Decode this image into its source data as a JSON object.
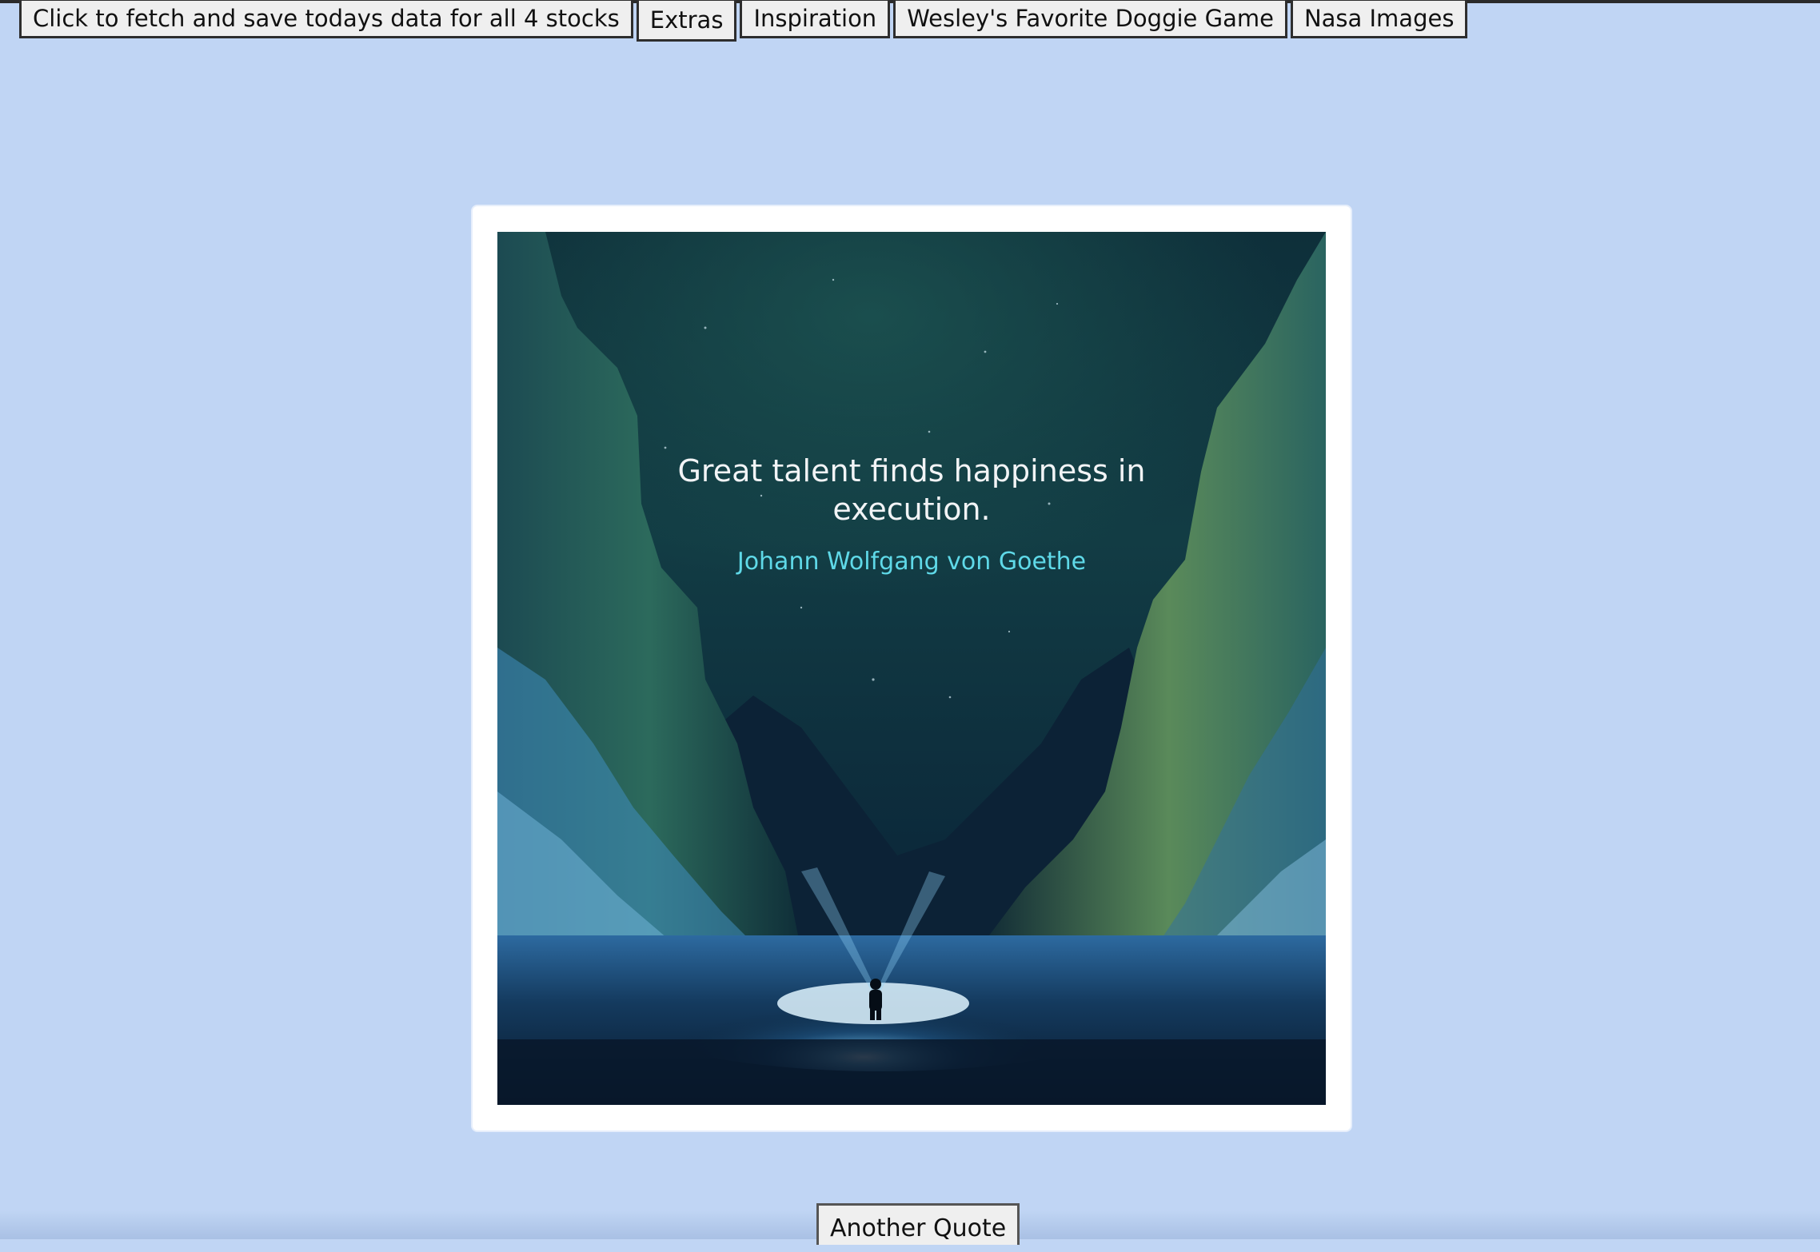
{
  "nav": {
    "buttons": [
      {
        "label": "Click to fetch and save todays data for all 4 stocks"
      },
      {
        "label": "Extras"
      },
      {
        "label": "Inspiration"
      },
      {
        "label": "Wesley's Favorite Doggie Game"
      },
      {
        "label": "Nasa Images"
      }
    ],
    "active_index": 1
  },
  "quote": {
    "text": "Great talent finds happiness in execution.",
    "author": "Johann Wolfgang von Goethe"
  },
  "actions": {
    "another_quote_label": "Another Quote"
  },
  "colors": {
    "page_background": "#c0d5f4",
    "card_background": "#ffffff",
    "quote_text": "#f2f4f6",
    "author_text": "#5fd9e8"
  }
}
